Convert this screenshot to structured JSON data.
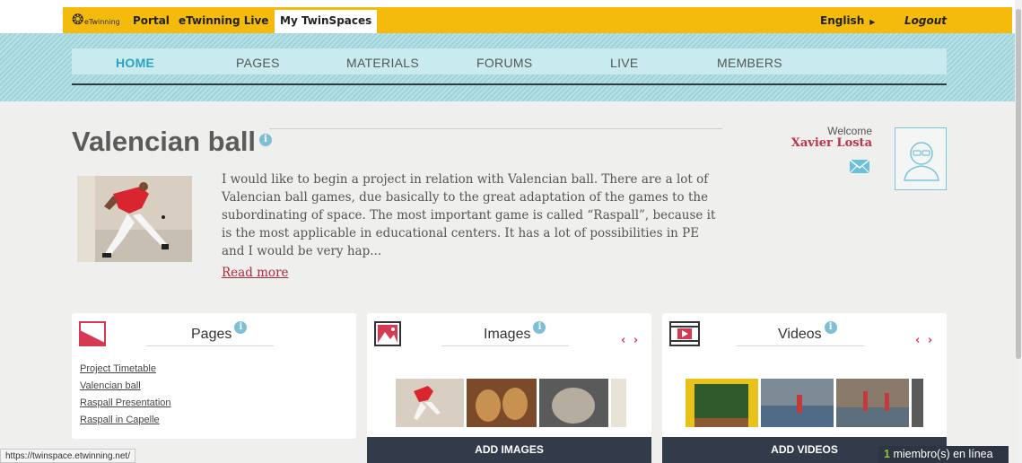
{
  "topbar": {
    "logo_text": "eTwinning",
    "links": [
      "Portal",
      "eTwinning Live",
      "My TwinSpaces"
    ],
    "language": "English",
    "logout": "Logout"
  },
  "nav": {
    "items": [
      "HOME",
      "PAGES",
      "MATERIALS",
      "FORUMS",
      "LIVE",
      "MEMBERS"
    ],
    "active": "HOME"
  },
  "project": {
    "title": "Valencian ball",
    "info_glyph": "i",
    "description": "I would like to begin a project in relation with Valencian ball. There are a lot of Valencian ball games, due basically to the great adaptation of the games to the subordinating of space. The most important game is called “Raspall”, because it is the most applicable in educational centers. It has a lot of possibilities in PE and I would be very hap...",
    "read_more": "Read more"
  },
  "user": {
    "welcome": "Welcome",
    "name": "Xavier Losta"
  },
  "cards": {
    "pages": {
      "title": "Pages",
      "links": [
        "Project Timetable",
        "Valencian ball",
        "Raspall Presentation",
        "Raspall in Capelle"
      ]
    },
    "images": {
      "title": "Images",
      "arrows": "‹ ›",
      "add_label": "ADD IMAGES"
    },
    "videos": {
      "title": "Videos",
      "arrows": "‹ ›",
      "add_label": "ADD VIDEOS"
    }
  },
  "status": {
    "url": "https://twinspace.etwinning.net/",
    "online_count": "1",
    "online_text": "miembro(s) en línea"
  },
  "colors": {
    "topbar": "#f5bb0c",
    "nav_active": "#2ba3c2",
    "accent_red": "#c0314a",
    "button_dark": "#333a4a"
  }
}
